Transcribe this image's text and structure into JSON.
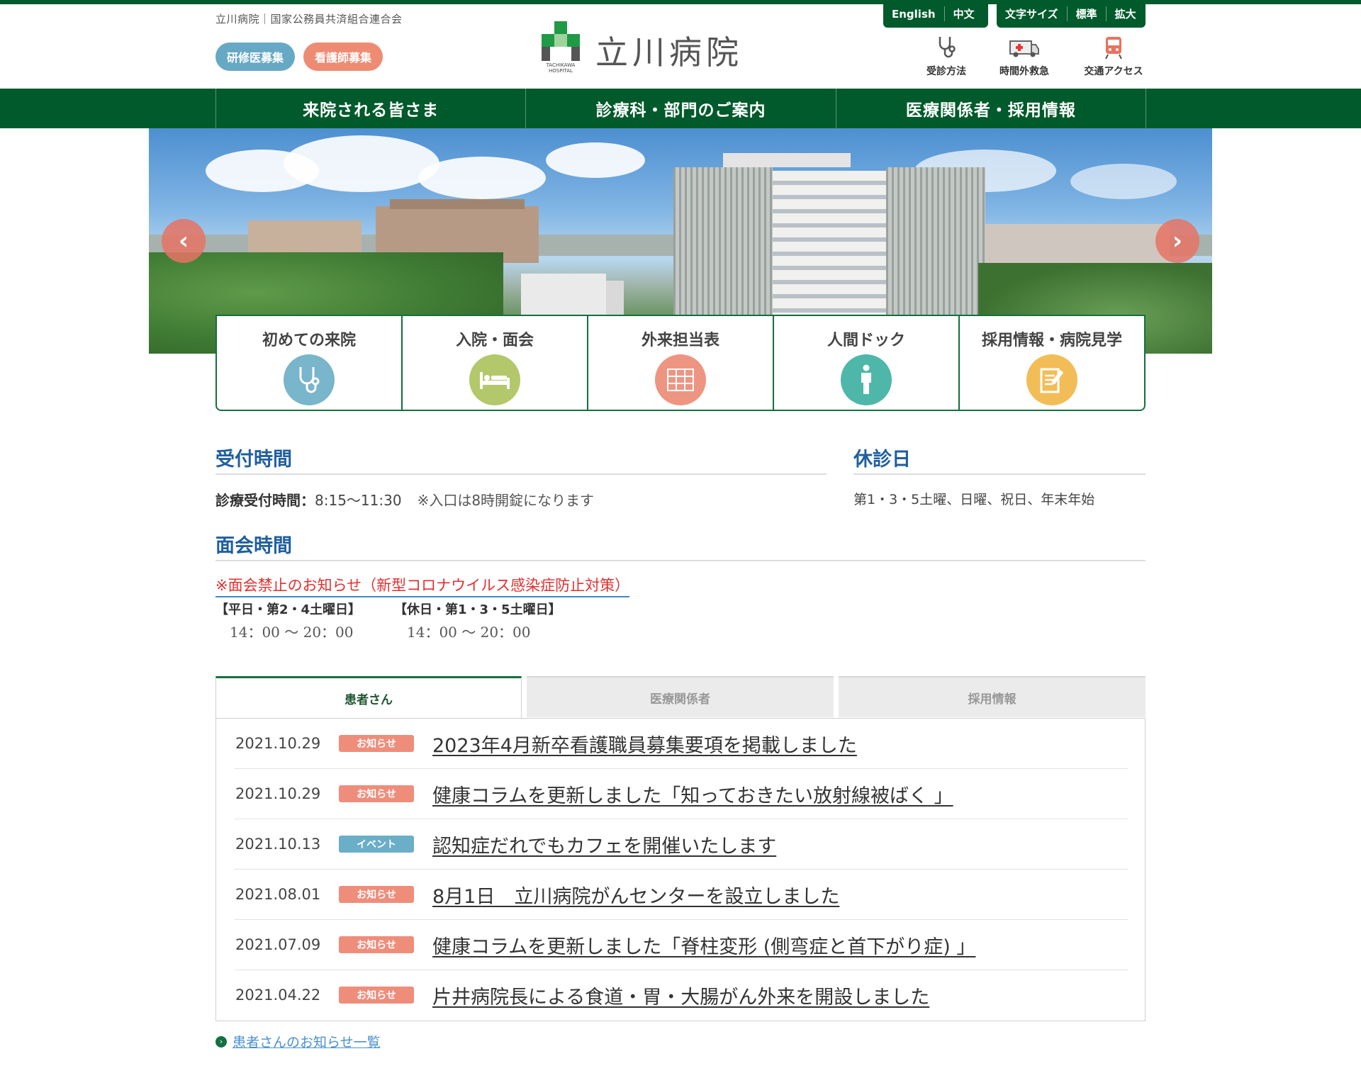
{
  "header": {
    "org": "立川病院｜国家公務員共済組合連合会",
    "recruit_resident": "研修医募集",
    "recruit_nurse": "看護師募集",
    "logo_sub": "TACHIKAWA HOSPITAL",
    "logo_text": "立川病院",
    "lang": {
      "english": "English",
      "chinese": "中文"
    },
    "fontsize": {
      "label": "文字サイズ",
      "standard": "標準",
      "large": "拡大"
    },
    "quick": {
      "consult": "受診方法",
      "emergency": "時間外救急",
      "access": "交通アクセス"
    }
  },
  "nav": [
    "来院される皆さま",
    "診療科・部門のご案内",
    "医療関係者・採用情報"
  ],
  "categories": [
    {
      "label": "初めての来院",
      "color": "#79b5cb"
    },
    {
      "label": "入院・面会",
      "color": "#b3c86a"
    },
    {
      "label": "外来担当表",
      "color": "#ee9582"
    },
    {
      "label": "人間ドック",
      "color": "#4fb7a9"
    },
    {
      "label": "採用情報・病院見学",
      "color": "#f2bd57"
    }
  ],
  "hours": {
    "title": "受付時間",
    "label": "診療受付時間：",
    "value": "8:15～11:30",
    "note": "※入口は8時開錠になります"
  },
  "holiday": {
    "title": "休診日",
    "text": "第1・3・5土曜、日曜、祝日、年末年始"
  },
  "visiting": {
    "title": "面会時間",
    "notice": "※面会禁止のお知らせ（新型コロナウイルス感染症防止対策）",
    "weekday_label": "【平日・第2・4土曜日】",
    "weekday_time": "14：00 ～ 20：00",
    "holiday_label": "【休日・第1・3・5土曜日】",
    "holiday_time": "14：00 ～ 20：00"
  },
  "tabs": [
    "患者さん",
    "医療関係者",
    "採用情報"
  ],
  "news": [
    {
      "date": "2021.10.29",
      "badge": "お知らせ",
      "type": "notice",
      "title": "2023年4月新卒看護職員募集要項を掲載しました"
    },
    {
      "date": "2021.10.29",
      "badge": "お知らせ",
      "type": "notice",
      "title": "健康コラムを更新しました「知っておきたい放射線被ばく 」"
    },
    {
      "date": "2021.10.13",
      "badge": "イベント",
      "type": "event",
      "title": "認知症だれでもカフェを開催いたします"
    },
    {
      "date": "2021.08.01",
      "badge": "お知らせ",
      "type": "notice",
      "title": "8月1日　立川病院がんセンターを設立しました"
    },
    {
      "date": "2021.07.09",
      "badge": "お知らせ",
      "type": "notice",
      "title": "健康コラムを更新しました「脊柱変形 (側弯症と首下がり症) 」"
    },
    {
      "date": "2021.04.22",
      "badge": "お知らせ",
      "type": "notice",
      "title": "片井病院長による食道・胃・大腸がん外来を開設しました"
    }
  ],
  "more_link": "患者さんのお知らせ一覧"
}
